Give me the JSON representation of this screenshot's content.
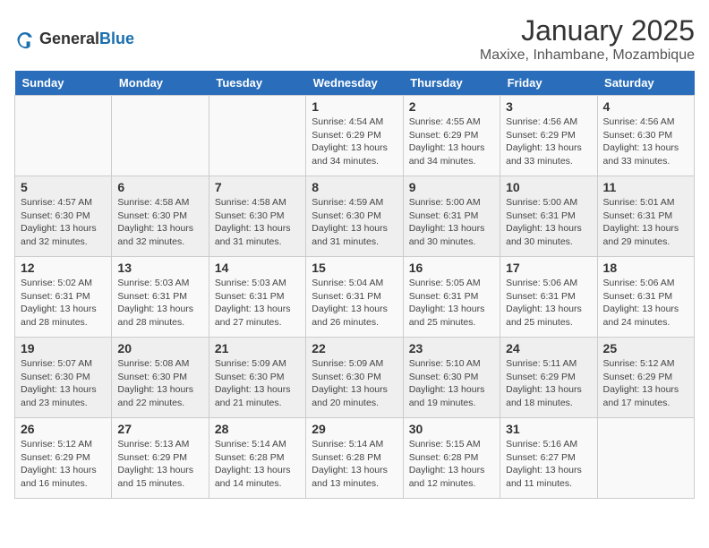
{
  "logo": {
    "general": "General",
    "blue": "Blue"
  },
  "title": "January 2025",
  "subtitle": "Maxixe, Inhambane, Mozambique",
  "days_of_week": [
    "Sunday",
    "Monday",
    "Tuesday",
    "Wednesday",
    "Thursday",
    "Friday",
    "Saturday"
  ],
  "weeks": [
    [
      {
        "day": "",
        "info": ""
      },
      {
        "day": "",
        "info": ""
      },
      {
        "day": "",
        "info": ""
      },
      {
        "day": "1",
        "info": "Sunrise: 4:54 AM\nSunset: 6:29 PM\nDaylight: 13 hours\nand 34 minutes."
      },
      {
        "day": "2",
        "info": "Sunrise: 4:55 AM\nSunset: 6:29 PM\nDaylight: 13 hours\nand 34 minutes."
      },
      {
        "day": "3",
        "info": "Sunrise: 4:56 AM\nSunset: 6:29 PM\nDaylight: 13 hours\nand 33 minutes."
      },
      {
        "day": "4",
        "info": "Sunrise: 4:56 AM\nSunset: 6:30 PM\nDaylight: 13 hours\nand 33 minutes."
      }
    ],
    [
      {
        "day": "5",
        "info": "Sunrise: 4:57 AM\nSunset: 6:30 PM\nDaylight: 13 hours\nand 32 minutes."
      },
      {
        "day": "6",
        "info": "Sunrise: 4:58 AM\nSunset: 6:30 PM\nDaylight: 13 hours\nand 32 minutes."
      },
      {
        "day": "7",
        "info": "Sunrise: 4:58 AM\nSunset: 6:30 PM\nDaylight: 13 hours\nand 31 minutes."
      },
      {
        "day": "8",
        "info": "Sunrise: 4:59 AM\nSunset: 6:30 PM\nDaylight: 13 hours\nand 31 minutes."
      },
      {
        "day": "9",
        "info": "Sunrise: 5:00 AM\nSunset: 6:31 PM\nDaylight: 13 hours\nand 30 minutes."
      },
      {
        "day": "10",
        "info": "Sunrise: 5:00 AM\nSunset: 6:31 PM\nDaylight: 13 hours\nand 30 minutes."
      },
      {
        "day": "11",
        "info": "Sunrise: 5:01 AM\nSunset: 6:31 PM\nDaylight: 13 hours\nand 29 minutes."
      }
    ],
    [
      {
        "day": "12",
        "info": "Sunrise: 5:02 AM\nSunset: 6:31 PM\nDaylight: 13 hours\nand 28 minutes."
      },
      {
        "day": "13",
        "info": "Sunrise: 5:03 AM\nSunset: 6:31 PM\nDaylight: 13 hours\nand 28 minutes."
      },
      {
        "day": "14",
        "info": "Sunrise: 5:03 AM\nSunset: 6:31 PM\nDaylight: 13 hours\nand 27 minutes."
      },
      {
        "day": "15",
        "info": "Sunrise: 5:04 AM\nSunset: 6:31 PM\nDaylight: 13 hours\nand 26 minutes."
      },
      {
        "day": "16",
        "info": "Sunrise: 5:05 AM\nSunset: 6:31 PM\nDaylight: 13 hours\nand 25 minutes."
      },
      {
        "day": "17",
        "info": "Sunrise: 5:06 AM\nSunset: 6:31 PM\nDaylight: 13 hours\nand 25 minutes."
      },
      {
        "day": "18",
        "info": "Sunrise: 5:06 AM\nSunset: 6:31 PM\nDaylight: 13 hours\nand 24 minutes."
      }
    ],
    [
      {
        "day": "19",
        "info": "Sunrise: 5:07 AM\nSunset: 6:30 PM\nDaylight: 13 hours\nand 23 minutes."
      },
      {
        "day": "20",
        "info": "Sunrise: 5:08 AM\nSunset: 6:30 PM\nDaylight: 13 hours\nand 22 minutes."
      },
      {
        "day": "21",
        "info": "Sunrise: 5:09 AM\nSunset: 6:30 PM\nDaylight: 13 hours\nand 21 minutes."
      },
      {
        "day": "22",
        "info": "Sunrise: 5:09 AM\nSunset: 6:30 PM\nDaylight: 13 hours\nand 20 minutes."
      },
      {
        "day": "23",
        "info": "Sunrise: 5:10 AM\nSunset: 6:30 PM\nDaylight: 13 hours\nand 19 minutes."
      },
      {
        "day": "24",
        "info": "Sunrise: 5:11 AM\nSunset: 6:29 PM\nDaylight: 13 hours\nand 18 minutes."
      },
      {
        "day": "25",
        "info": "Sunrise: 5:12 AM\nSunset: 6:29 PM\nDaylight: 13 hours\nand 17 minutes."
      }
    ],
    [
      {
        "day": "26",
        "info": "Sunrise: 5:12 AM\nSunset: 6:29 PM\nDaylight: 13 hours\nand 16 minutes."
      },
      {
        "day": "27",
        "info": "Sunrise: 5:13 AM\nSunset: 6:29 PM\nDaylight: 13 hours\nand 15 minutes."
      },
      {
        "day": "28",
        "info": "Sunrise: 5:14 AM\nSunset: 6:28 PM\nDaylight: 13 hours\nand 14 minutes."
      },
      {
        "day": "29",
        "info": "Sunrise: 5:14 AM\nSunset: 6:28 PM\nDaylight: 13 hours\nand 13 minutes."
      },
      {
        "day": "30",
        "info": "Sunrise: 5:15 AM\nSunset: 6:28 PM\nDaylight: 13 hours\nand 12 minutes."
      },
      {
        "day": "31",
        "info": "Sunrise: 5:16 AM\nSunset: 6:27 PM\nDaylight: 13 hours\nand 11 minutes."
      },
      {
        "day": "",
        "info": ""
      }
    ]
  ]
}
